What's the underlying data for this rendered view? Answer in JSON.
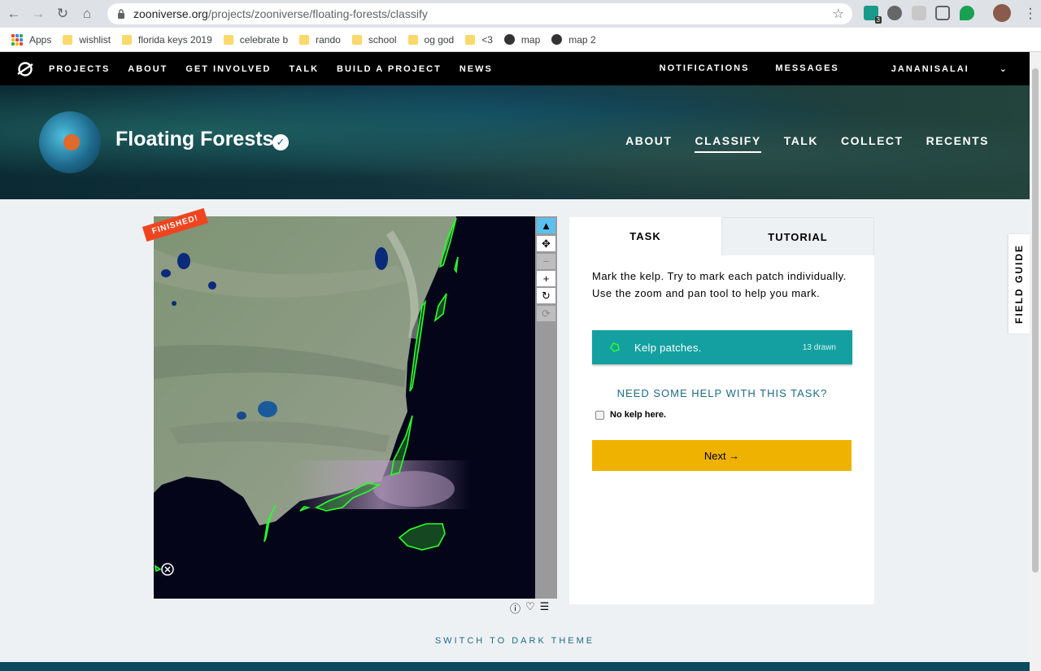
{
  "browser": {
    "url_domain": "zooniverse.org",
    "url_path": "/projects/zooniverse/floating-forests/classify",
    "ext_badge": "3",
    "bookmarks": [
      "Apps",
      "wishlist",
      "florida keys 2019",
      "celebrate b",
      "rando",
      "school",
      "og god",
      "<3",
      "map",
      "map 2"
    ]
  },
  "site_nav": {
    "links": [
      "PROJECTS",
      "ABOUT",
      "GET INVOLVED",
      "TALK",
      "BUILD A PROJECT",
      "NEWS"
    ],
    "notifications": "NOTIFICATIONS",
    "messages": "MESSAGES",
    "user": "JANANISALAI"
  },
  "project": {
    "title": "Floating Forests",
    "nav": [
      "ABOUT",
      "CLASSIFY",
      "TALK",
      "COLLECT",
      "RECENTS"
    ],
    "active_nav": "CLASSIFY"
  },
  "viewer": {
    "finished_badge": "FINISHED!",
    "tools": [
      "pointer-icon",
      "pan-icon",
      "zoom-out-icon",
      "zoom-in-icon",
      "rotate-icon",
      "reset-icon"
    ]
  },
  "task_panel": {
    "tab_task": "TASK",
    "tab_tutorial": "TUTORIAL",
    "instructions": "Mark the kelp. Try to mark each patch individually. Use the zoom and pan tool to help you mark.",
    "tool_label": "Kelp patches.",
    "tool_count": "13 drawn",
    "help_link": "NEED SOME HELP WITH THIS TASK?",
    "no_kelp": "No kelp here.",
    "next": "Next →"
  },
  "field_guide": "FIELD GUIDE",
  "dark_theme": "SWITCH TO DARK THEME",
  "colors": {
    "accent_teal": "#14a0a0",
    "next_yellow": "#f0b200",
    "finished_red": "#f0441f",
    "kelp_green": "#2aff2a"
  }
}
